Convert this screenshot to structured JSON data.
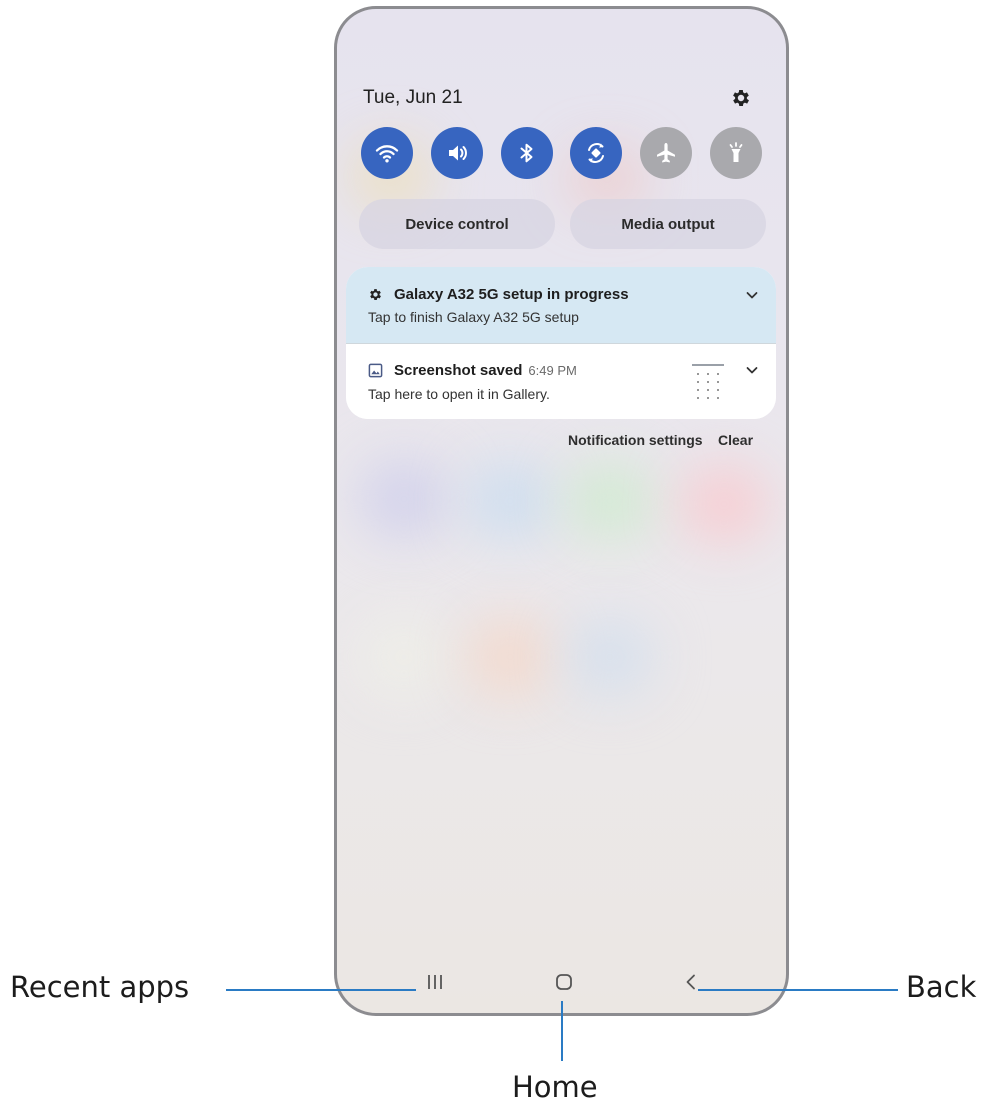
{
  "panel": {
    "date": "Tue, Jun 21",
    "settings_icon": "gear-icon"
  },
  "quick_settings": [
    {
      "name": "wifi",
      "icon": "wifi-icon",
      "state": "on",
      "color": "#3765c0"
    },
    {
      "name": "sound",
      "icon": "volume-icon",
      "state": "on",
      "color": "#3765c0"
    },
    {
      "name": "bluetooth",
      "icon": "bluetooth-icon",
      "state": "on",
      "color": "#3765c0"
    },
    {
      "name": "auto-rotate",
      "icon": "auto-rotate-icon",
      "state": "on",
      "color": "#3765c0"
    },
    {
      "name": "airplane-mode",
      "icon": "airplane-icon",
      "state": "off",
      "color": "#a9a9ad"
    },
    {
      "name": "flashlight",
      "icon": "flashlight-icon",
      "state": "off",
      "color": "#a9a9ad"
    }
  ],
  "pills": {
    "device_control": "Device control",
    "media_output": "Media output"
  },
  "notifications": [
    {
      "icon": "gear-icon",
      "title": "Galaxy A32 5G setup in progress",
      "body": "Tap to finish Galaxy A32 5G setup",
      "background": "#d6e8f3"
    },
    {
      "icon": "image-icon",
      "title": "Screenshot saved",
      "time": "6:49 PM",
      "body": "Tap here to open it in Gallery.",
      "background": "#ffffff"
    }
  ],
  "notification_actions": {
    "settings": "Notification settings",
    "clear": "Clear"
  },
  "navigation": {
    "recent_icon": "recent-apps-icon",
    "home_icon": "home-icon",
    "back_icon": "back-icon"
  },
  "callouts": {
    "recent_apps": "Recent apps",
    "home": "Home",
    "back": "Back",
    "line_color": "#2a7bc4"
  }
}
